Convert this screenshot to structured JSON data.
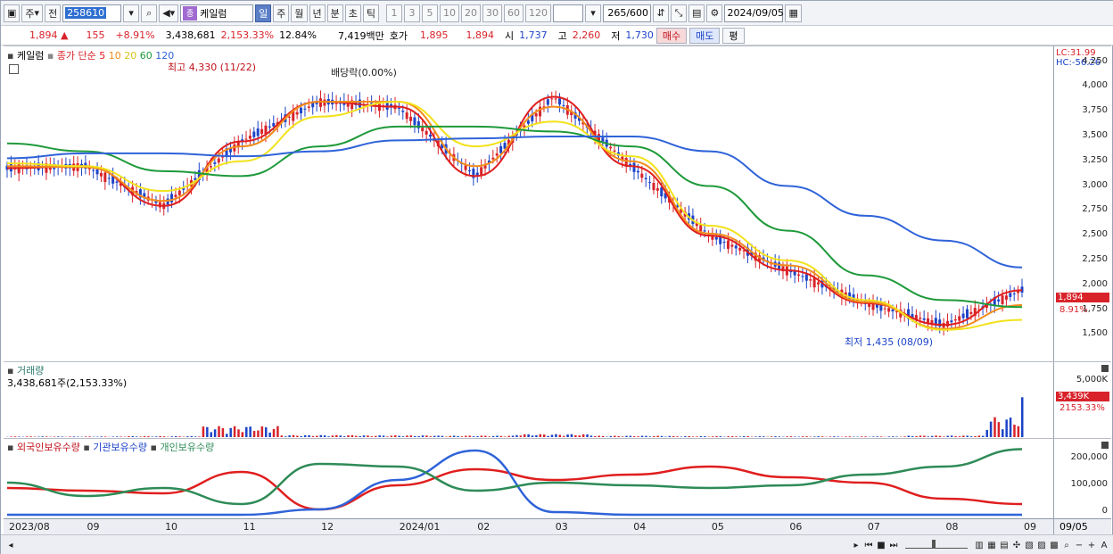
{
  "toolbar": {
    "period_type": "주",
    "prev_label": "전",
    "stock_code": "258610",
    "stock_name": "케일럼",
    "jong_badge": "종",
    "period_buttons": [
      "일",
      "주",
      "월",
      "년",
      "분",
      "초",
      "틱"
    ],
    "active_period": "일",
    "interval_buttons": [
      "1",
      "3",
      "5",
      "10",
      "20",
      "30",
      "60",
      "120"
    ],
    "count_value": "265",
    "count_total": "/600",
    "date_value": "2024/09/05"
  },
  "quote": {
    "price": "1,894",
    "arrow": "▲",
    "change": "155",
    "change_pct": "+8.91%",
    "volume": "3,438,681",
    "volume_ratio": "2,153.33%",
    "turnover": "12.84%",
    "amount": "7,419백만",
    "bid_ask_label": "호가",
    "ask": "1,895",
    "bid": "1,894",
    "open_label": "시",
    "open": "1,737",
    "high_label": "고",
    "high": "2,260",
    "low_label": "저",
    "low": "1,730",
    "buy_label": "매수",
    "sell_label": "매도",
    "eval_label": "평"
  },
  "price_pane": {
    "stock_label": "케일럼",
    "ma_title": "종가 단순",
    "ma_periods": [
      "5",
      "10",
      "20",
      "60",
      "120"
    ],
    "ma_colors": [
      "#e01e1e",
      "#f28c1c",
      "#f2e21c",
      "#1e9a3a",
      "#2f63d9"
    ],
    "max_annotation": "최고 4,330 (11/22)",
    "dividend_annotation": "배당락(0.00%)",
    "min_annotation": "최저 1,435 (08/09)",
    "lc_label": "LC:31.99",
    "hc_label": "HC:-56.26",
    "current_price_tag": "1,894",
    "current_pct_tag": "8.91%",
    "y_ticks": [
      "4,250",
      "4,000",
      "3,750",
      "3,500",
      "3,250",
      "3,000",
      "2,750",
      "2,500",
      "2,250",
      "2,000",
      "1,750",
      "1,500"
    ]
  },
  "volume_pane": {
    "title": "거래량",
    "value_text": "3,438,681주(2,153.33%)",
    "y_tick": "5,000K",
    "current_tag": "3,439K",
    "current_pct": "2153.33%"
  },
  "holdings_pane": {
    "legend": [
      "외국인보유수량",
      "기관보유수량",
      "개인보유수량"
    ],
    "legend_colors": [
      "#e01e1e",
      "#2f63d9",
      "#2e8b57"
    ],
    "y_ticks": [
      "200,000",
      "100,000",
      "0"
    ]
  },
  "x_axis": {
    "labels": [
      "2023/08",
      "09",
      "10",
      "11",
      "12",
      "2024/01",
      "02",
      "03",
      "04",
      "05",
      "06",
      "07",
      "08",
      "09"
    ],
    "right_label": "09/05"
  },
  "chart_data": [
    {
      "type": "line",
      "title": "케일럼",
      "xlabel": "",
      "ylabel": "",
      "ylim": [
        1350,
        4300
      ],
      "x": [
        "2023/08",
        "09",
        "10",
        "11",
        "12",
        "2024/01",
        "02",
        "03",
        "04",
        "05",
        "06",
        "07",
        "08",
        "09"
      ],
      "series": [
        {
          "name": "5",
          "values": [
            3180,
            3200,
            2800,
            3450,
            3850,
            3800,
            3100,
            3900,
            3200,
            2500,
            2150,
            1820,
            1600,
            1950
          ]
        },
        {
          "name": "10",
          "values": [
            3200,
            3190,
            2850,
            3400,
            3850,
            3850,
            3200,
            3800,
            3250,
            2520,
            2200,
            1830,
            1560,
            1800
          ]
        },
        {
          "name": "20",
          "values": [
            3230,
            3200,
            2950,
            3250,
            3700,
            3850,
            3400,
            3650,
            3300,
            2600,
            2250,
            1850,
            1550,
            1650
          ]
        },
        {
          "name": "60",
          "values": [
            3430,
            3350,
            3150,
            3100,
            3400,
            3600,
            3600,
            3550,
            3400,
            3000,
            2550,
            2100,
            1850,
            1780
          ]
        },
        {
          "name": "120",
          "values": [
            3280,
            3330,
            3330,
            3300,
            3350,
            3460,
            3480,
            3500,
            3500,
            3350,
            3000,
            2700,
            2450,
            2180
          ]
        }
      ]
    },
    {
      "type": "bar",
      "title": "거래량",
      "categories": [
        "2023/08",
        "09",
        "10",
        "11",
        "12",
        "2024/01",
        "02",
        "03",
        "04",
        "05",
        "06",
        "07",
        "08",
        "09"
      ],
      "values": [
        120,
        110,
        160,
        1900,
        350,
        300,
        250,
        520,
        230,
        170,
        140,
        120,
        260,
        3439
      ],
      "ylim": [
        0,
        6000
      ],
      "ylabel": "K"
    },
    {
      "type": "line",
      "title": "",
      "ylim": [
        -20000,
        240000
      ],
      "x": [
        "2023/08",
        "09",
        "10",
        "11",
        "12",
        "2024/01",
        "02",
        "03",
        "04",
        "05",
        "06",
        "07",
        "08",
        "09"
      ],
      "series": [
        {
          "name": "외국인보유수량",
          "values": [
            90000,
            80000,
            70000,
            150000,
            10000,
            100000,
            160000,
            120000,
            140000,
            170000,
            130000,
            110000,
            50000,
            30000
          ]
        },
        {
          "name": "기관보유수량",
          "values": [
            -10000,
            -10000,
            -10000,
            -10000,
            10000,
            120000,
            230000,
            0,
            -10000,
            -10000,
            -10000,
            -10000,
            -10000,
            -10000
          ]
        },
        {
          "name": "개인보유수량",
          "values": [
            110000,
            60000,
            90000,
            30000,
            180000,
            170000,
            80000,
            110000,
            100000,
            90000,
            100000,
            140000,
            170000,
            235000
          ]
        }
      ]
    }
  ]
}
